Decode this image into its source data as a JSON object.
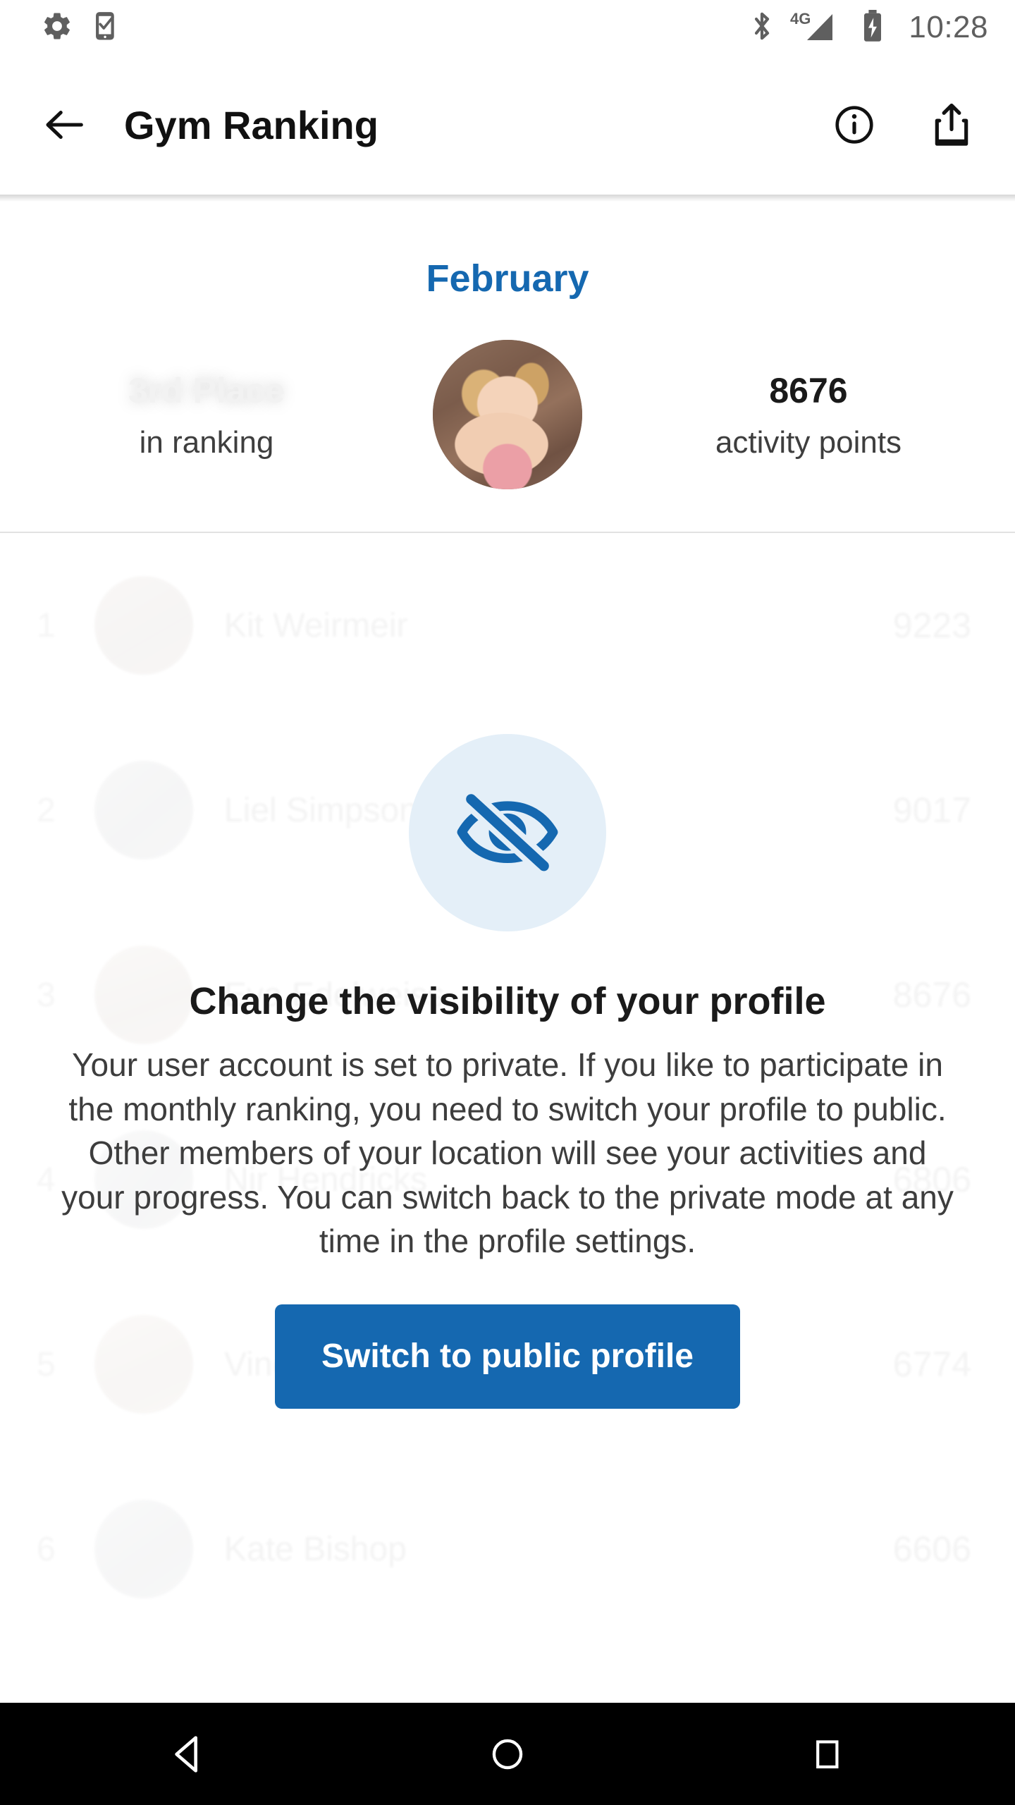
{
  "status_bar": {
    "time": "10:28",
    "icons": [
      "settings-icon",
      "phone-check-icon",
      "bluetooth-icon",
      "signal-4g-icon",
      "battery-charging-icon"
    ],
    "network_label": "4G"
  },
  "app_bar": {
    "title": "Gym Ranking",
    "back_icon": "back-arrow-icon",
    "info_icon": "info-circle-icon",
    "share_icon": "share-icon"
  },
  "header": {
    "month": "February",
    "place": "3rd Place",
    "place_sub": "in ranking",
    "points": "8676",
    "points_sub": "activity points"
  },
  "ranking": {
    "rows": [
      {
        "rank": "1",
        "name": "Kit Weirmeir",
        "score": "9223"
      },
      {
        "rank": "2",
        "name": "Liel Simpson",
        "score": "9017"
      },
      {
        "rank": "3",
        "name": "Eva Edelweiss",
        "score": "8676"
      },
      {
        "rank": "4",
        "name": "Nir Hendricks",
        "score": "6806"
      },
      {
        "rank": "5",
        "name": "Vincent Aegerbaum",
        "score": "6774"
      },
      {
        "rank": "6",
        "name": "Kate Bishop",
        "score": "6606"
      }
    ]
  },
  "overlay": {
    "icon": "eye-off-icon",
    "title": "Change the visibility of your profile",
    "body": "Your user account is set to private. If you like to participate in the monthly ranking, you need to switch your profile to public. Other members of your location will see your activities and your progress. You can switch back to the private mode at any time in the profile settings.",
    "cta_label": "Switch to public profile"
  },
  "nav_bar": {
    "back": "nav-back-icon",
    "home": "nav-home-icon",
    "recents": "nav-recents-icon"
  },
  "colors": {
    "accent": "#1568B0",
    "accent_soft": "#E4EFF8",
    "text": "#1a1a1a",
    "muted": "#3d3d3d",
    "nav_bg": "#000000"
  }
}
